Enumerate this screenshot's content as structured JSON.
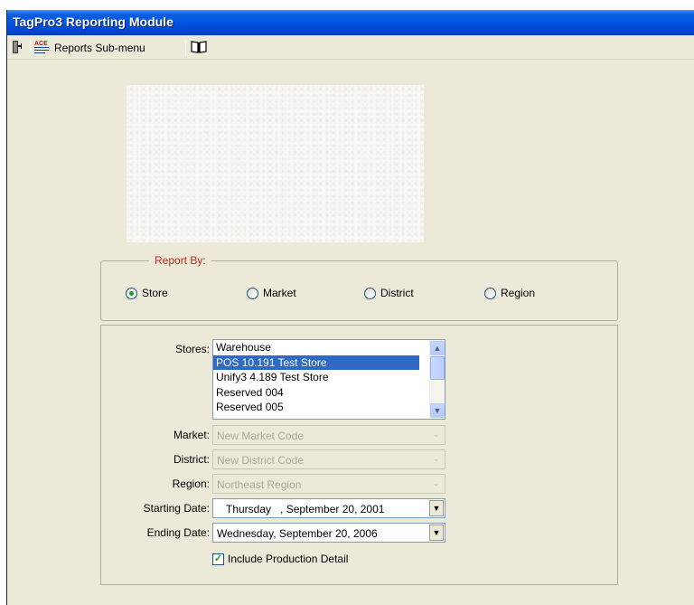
{
  "window": {
    "title": "TagPro3 Reporting Module"
  },
  "toolbar": {
    "exit_icon": "exit-door-icon",
    "reports_icon": "ace-report-icon",
    "reports_label": "Reports Sub-menu",
    "help_icon": "book-icon"
  },
  "report_by": {
    "legend": "Report By:",
    "options": [
      "Store",
      "Market",
      "District",
      "Region"
    ],
    "selected": "Store"
  },
  "filters": {
    "stores_label": "Stores:",
    "stores": [
      "Warehouse",
      "POS 10.191 Test Store",
      "Unify3 4.189 Test Store",
      "Reserved 004",
      "Reserved 005"
    ],
    "selected_store": "POS 10.191 Test Store",
    "market_label": "Market:",
    "market_value": "New Market Code",
    "district_label": "District:",
    "district_value": "New District Code",
    "region_label": "Region:",
    "region_value": "Northeast Region",
    "start_label": "Starting Date:",
    "start_value": "Thursday   , September 20, 2001",
    "end_label": "Ending Date:",
    "end_value": "Wednesday, September 20, 2006",
    "include_label": "Include Production Detail",
    "include_checked": true
  },
  "colors": {
    "titlebar": "#0054e3",
    "legend_text": "#c0281e",
    "selection": "#316ac5",
    "window_bg": "#ece9d8"
  }
}
